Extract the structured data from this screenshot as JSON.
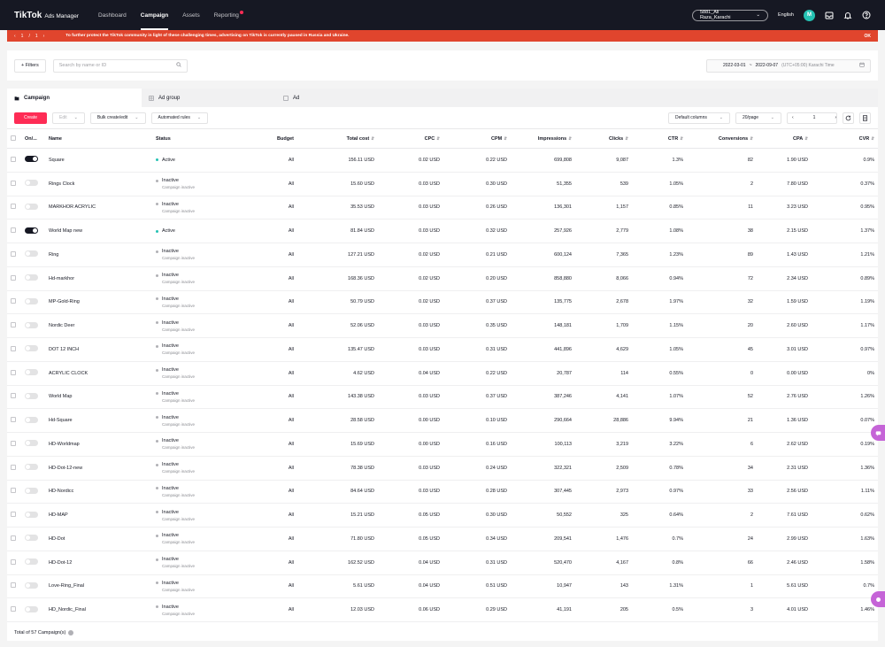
{
  "nav": {
    "logo_main": "TikTok",
    "logo_sub": "Ads Manager",
    "items": [
      "Dashboard",
      "Campaign",
      "Assets",
      "Reporting"
    ],
    "account": "5881_Ali Raza_Karachi",
    "language": "English",
    "avatar": "M"
  },
  "banner": {
    "page_current": "1",
    "page_sep": "/",
    "page_total": "1",
    "message": "To further protect the TikTok community in light of these challenging times, advertising on TikTok is currently paused in Russia and Ukraine.",
    "ok": "OK",
    "color": "#e0452d"
  },
  "filters": {
    "filters_label": "+ Filters",
    "search_placeholder": "Search by name or ID",
    "date_start": "2022-03-01",
    "date_sep": "~",
    "date_end": "2022-09-07",
    "timezone": "(UTC+05:00) Karachi Time"
  },
  "tabs": [
    "Campaign",
    "Ad group",
    "Ad"
  ],
  "toolbar": {
    "create": "Create",
    "edit": "Edit",
    "bulk": "Bulk create/edit",
    "automated": "Automated rules",
    "columns": "Default columns",
    "per_page": "20/page",
    "page": "1"
  },
  "table": {
    "columns": [
      "On/...",
      "Name",
      "Status",
      "Budget",
      "Total cost",
      "CPC",
      "CPM",
      "Impressions",
      "Clicks",
      "CTR",
      "Conversions",
      "CPA",
      "CVR"
    ],
    "rows": [
      {
        "on": true,
        "name": "Square",
        "status": "Active",
        "sub": "",
        "budget": "All",
        "cost": "156.11 USD",
        "cpc": "0.02 USD",
        "cpm": "0.22 USD",
        "imp": "699,808",
        "clicks": "9,087",
        "ctr": "1.3%",
        "conv": "82",
        "cpa": "1.90 USD",
        "cvr": "0.9%"
      },
      {
        "on": false,
        "name": "Rings Clock",
        "status": "Inactive",
        "sub": "Campaign inactive",
        "budget": "All",
        "cost": "15.60 USD",
        "cpc": "0.03 USD",
        "cpm": "0.30 USD",
        "imp": "51,355",
        "clicks": "539",
        "ctr": "1.05%",
        "conv": "2",
        "cpa": "7.80 USD",
        "cvr": "0.37%"
      },
      {
        "on": false,
        "name": "MARKHOR ACRYLIC",
        "status": "Inactive",
        "sub": "Campaign inactive",
        "budget": "All",
        "cost": "35.53 USD",
        "cpc": "0.03 USD",
        "cpm": "0.26 USD",
        "imp": "136,301",
        "clicks": "1,157",
        "ctr": "0.85%",
        "conv": "11",
        "cpa": "3.23 USD",
        "cvr": "0.95%"
      },
      {
        "on": true,
        "name": "World Map new",
        "status": "Active",
        "sub": "",
        "budget": "All",
        "cost": "81.84 USD",
        "cpc": "0.03 USD",
        "cpm": "0.32 USD",
        "imp": "257,926",
        "clicks": "2,779",
        "ctr": "1.08%",
        "conv": "38",
        "cpa": "2.15 USD",
        "cvr": "1.37%"
      },
      {
        "on": false,
        "name": "Ring",
        "status": "Inactive",
        "sub": "Campaign inactive",
        "budget": "All",
        "cost": "127.21 USD",
        "cpc": "0.02 USD",
        "cpm": "0.21 USD",
        "imp": "600,124",
        "clicks": "7,365",
        "ctr": "1.23%",
        "conv": "89",
        "cpa": "1.43 USD",
        "cvr": "1.21%"
      },
      {
        "on": false,
        "name": "Hd-markhor",
        "status": "Inactive",
        "sub": "Campaign inactive",
        "budget": "All",
        "cost": "168.36 USD",
        "cpc": "0.02 USD",
        "cpm": "0.20 USD",
        "imp": "858,880",
        "clicks": "8,066",
        "ctr": "0.94%",
        "conv": "72",
        "cpa": "2.34 USD",
        "cvr": "0.89%"
      },
      {
        "on": false,
        "name": "MP-Gold-Ring",
        "status": "Inactive",
        "sub": "Campaign inactive",
        "budget": "All",
        "cost": "50.79 USD",
        "cpc": "0.02 USD",
        "cpm": "0.37 USD",
        "imp": "135,775",
        "clicks": "2,678",
        "ctr": "1.97%",
        "conv": "32",
        "cpa": "1.59 USD",
        "cvr": "1.19%"
      },
      {
        "on": false,
        "name": "Nordic Deer",
        "status": "Inactive",
        "sub": "Campaign inactive",
        "budget": "All",
        "cost": "52.06 USD",
        "cpc": "0.03 USD",
        "cpm": "0.35 USD",
        "imp": "148,181",
        "clicks": "1,709",
        "ctr": "1.15%",
        "conv": "20",
        "cpa": "2.60 USD",
        "cvr": "1.17%"
      },
      {
        "on": false,
        "name": "DOT 12 INCH",
        "status": "Inactive",
        "sub": "Campaign inactive",
        "budget": "All",
        "cost": "135.47 USD",
        "cpc": "0.03 USD",
        "cpm": "0.31 USD",
        "imp": "441,896",
        "clicks": "4,629",
        "ctr": "1.05%",
        "conv": "45",
        "cpa": "3.01 USD",
        "cvr": "0.97%"
      },
      {
        "on": false,
        "name": "ACRYLIC CLOCK",
        "status": "Inactive",
        "sub": "Campaign inactive",
        "budget": "All",
        "cost": "4.62 USD",
        "cpc": "0.04 USD",
        "cpm": "0.22 USD",
        "imp": "20,787",
        "clicks": "114",
        "ctr": "0.55%",
        "conv": "0",
        "cpa": "0.00 USD",
        "cvr": "0%"
      },
      {
        "on": false,
        "name": "World Map",
        "status": "Inactive",
        "sub": "Campaign inactive",
        "budget": "All",
        "cost": "143.38 USD",
        "cpc": "0.03 USD",
        "cpm": "0.37 USD",
        "imp": "387,246",
        "clicks": "4,141",
        "ctr": "1.07%",
        "conv": "52",
        "cpa": "2.76 USD",
        "cvr": "1.26%"
      },
      {
        "on": false,
        "name": "Hd-Square",
        "status": "Inactive",
        "sub": "Campaign inactive",
        "budget": "All",
        "cost": "28.58 USD",
        "cpc": "0.00 USD",
        "cpm": "0.10 USD",
        "imp": "290,664",
        "clicks": "28,886",
        "ctr": "9.94%",
        "conv": "21",
        "cpa": "1.36 USD",
        "cvr": "0.07%"
      },
      {
        "on": false,
        "name": "HD-Worldmap",
        "status": "Inactive",
        "sub": "Campaign inactive",
        "budget": "All",
        "cost": "15.69 USD",
        "cpc": "0.00 USD",
        "cpm": "0.16 USD",
        "imp": "100,113",
        "clicks": "3,219",
        "ctr": "3.22%",
        "conv": "6",
        "cpa": "2.62 USD",
        "cvr": "0.19%"
      },
      {
        "on": false,
        "name": "HD-Dot-12-new",
        "status": "Inactive",
        "sub": "Campaign inactive",
        "budget": "All",
        "cost": "78.38 USD",
        "cpc": "0.03 USD",
        "cpm": "0.24 USD",
        "imp": "322,321",
        "clicks": "2,509",
        "ctr": "0.78%",
        "conv": "34",
        "cpa": "2.31 USD",
        "cvr": "1.36%"
      },
      {
        "on": false,
        "name": "HD-Nordicc",
        "status": "Inactive",
        "sub": "Campaign inactive",
        "budget": "All",
        "cost": "84.64 USD",
        "cpc": "0.03 USD",
        "cpm": "0.28 USD",
        "imp": "307,445",
        "clicks": "2,973",
        "ctr": "0.97%",
        "conv": "33",
        "cpa": "2.56 USD",
        "cvr": "1.11%"
      },
      {
        "on": false,
        "name": "HD-MAP",
        "status": "Inactive",
        "sub": "Campaign inactive",
        "budget": "All",
        "cost": "15.21 USD",
        "cpc": "0.05 USD",
        "cpm": "0.30 USD",
        "imp": "50,552",
        "clicks": "325",
        "ctr": "0.64%",
        "conv": "2",
        "cpa": "7.61 USD",
        "cvr": "0.62%"
      },
      {
        "on": false,
        "name": "HD-Dot",
        "status": "Inactive",
        "sub": "Campaign inactive",
        "budget": "All",
        "cost": "71.80 USD",
        "cpc": "0.05 USD",
        "cpm": "0.34 USD",
        "imp": "209,541",
        "clicks": "1,476",
        "ctr": "0.7%",
        "conv": "24",
        "cpa": "2.99 USD",
        "cvr": "1.63%"
      },
      {
        "on": false,
        "name": "HD-Dot-12",
        "status": "Inactive",
        "sub": "Campaign inactive",
        "budget": "All",
        "cost": "162.52 USD",
        "cpc": "0.04 USD",
        "cpm": "0.31 USD",
        "imp": "520,470",
        "clicks": "4,167",
        "ctr": "0.8%",
        "conv": "66",
        "cpa": "2.46 USD",
        "cvr": "1.58%"
      },
      {
        "on": false,
        "name": "Love-Ring_Final",
        "status": "Inactive",
        "sub": "Campaign inactive",
        "budget": "All",
        "cost": "5.61 USD",
        "cpc": "0.04 USD",
        "cpm": "0.51 USD",
        "imp": "10,947",
        "clicks": "143",
        "ctr": "1.31%",
        "conv": "1",
        "cpa": "5.61 USD",
        "cvr": "0.7%"
      },
      {
        "on": false,
        "name": "HD_Nordic_Final",
        "status": "Inactive",
        "sub": "Campaign inactive",
        "budget": "All",
        "cost": "12.03 USD",
        "cpc": "0.06 USD",
        "cpm": "0.29 USD",
        "imp": "41,191",
        "clicks": "205",
        "ctr": "0.5%",
        "conv": "3",
        "cpa": "4.01 USD",
        "cvr": "1.46%"
      }
    ]
  },
  "footer": {
    "total": "Total of 57 Campaign(s)"
  },
  "colors": {
    "primary": "#fe2c55",
    "nav_bg": "#161823",
    "active_dot": "#25c2b3",
    "float": "#c564d7"
  }
}
